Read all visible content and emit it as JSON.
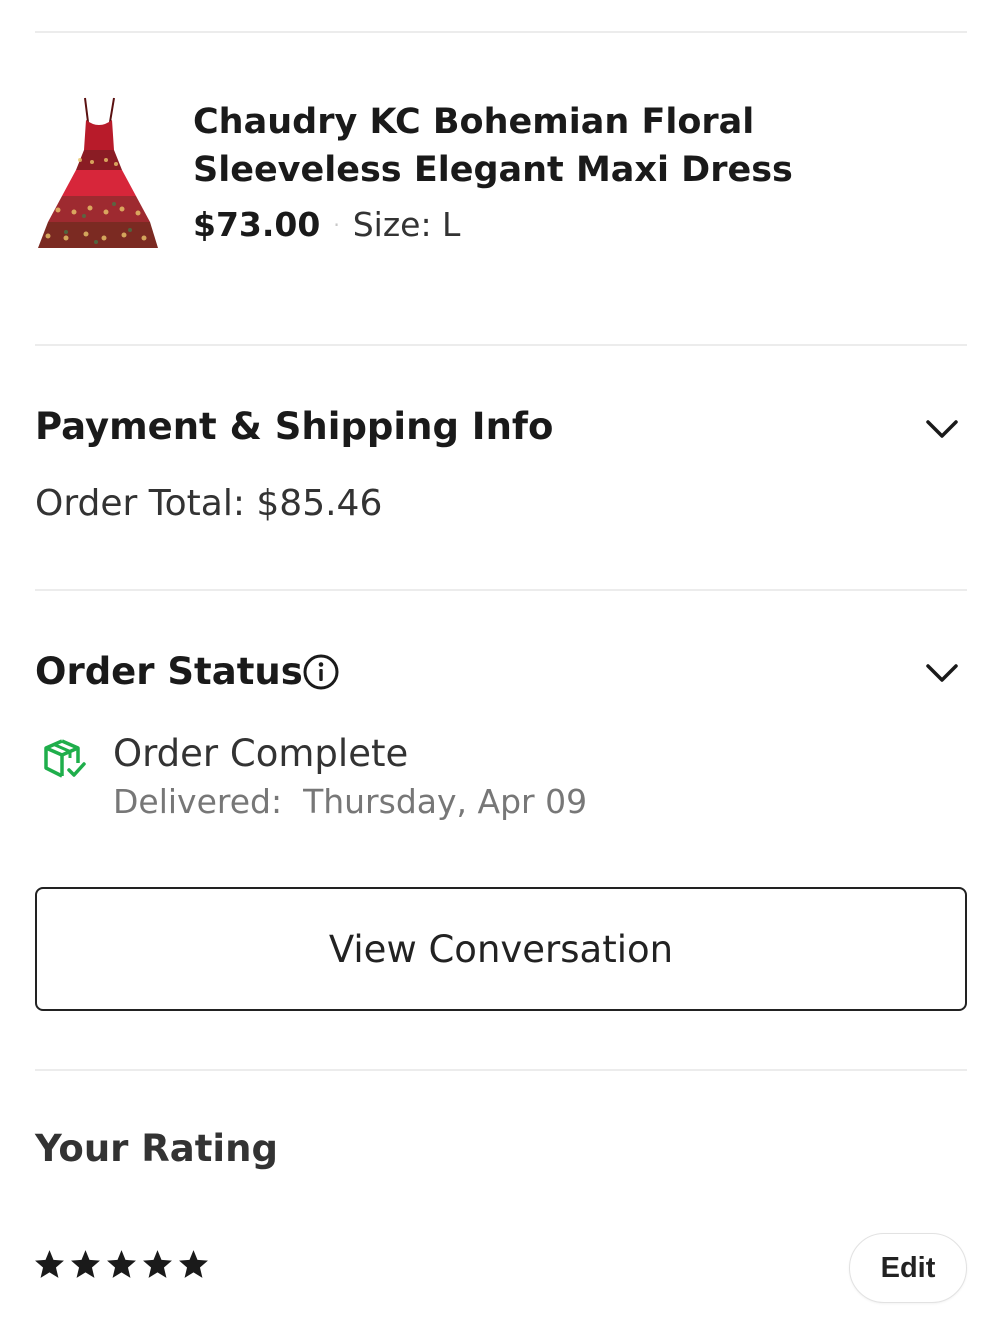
{
  "product": {
    "title": "Chaudry KC Bohemian Floral Sleeveless Elegant Maxi Dress",
    "price": "$73.00",
    "separator": "·",
    "size": "Size: L",
    "image_icon": "dress-image"
  },
  "payment": {
    "title": "Payment & Shipping Info",
    "order_total": "Order Total: $85.46",
    "chevron_icon": "chevron-down-icon"
  },
  "order_status": {
    "title": "Order Status",
    "info_icon": "info-icon",
    "chevron_icon": "chevron-down-icon",
    "status_icon": "package-check-icon",
    "status": "Order Complete",
    "delivered": "Delivered:  Thursday, Apr 09"
  },
  "actions": {
    "view_conversation": "View Conversation"
  },
  "rating": {
    "title": "Your Rating",
    "stars": 5,
    "max_stars": 5,
    "edit_label": "Edit"
  },
  "colors": {
    "status_green": "#1fae4b",
    "text_dark": "#1a1a1a",
    "divider": "#ececec"
  }
}
